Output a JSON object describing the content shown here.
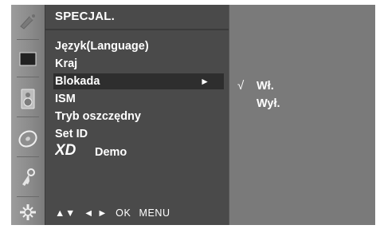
{
  "menu": {
    "title": "SPECJAL.",
    "items": [
      {
        "label": "Język(Language)"
      },
      {
        "label": "Kraj"
      },
      {
        "label": "Blokada",
        "arrow": "►"
      },
      {
        "label": "ISM"
      },
      {
        "label": "Tryb oszczędny"
      },
      {
        "label": "Set ID"
      },
      {
        "label": "XD Demo",
        "logo": "XD",
        "text": "Demo"
      }
    ],
    "selected_index": 2
  },
  "submenu": {
    "check_mark": "√",
    "items": [
      {
        "label": "Wł.",
        "checked": true
      },
      {
        "label": "Wył.",
        "checked": false
      }
    ]
  },
  "nav_hint": {
    "updown": "▲▼",
    "leftright": "◄ ►",
    "ok": "OK",
    "menu": "MENU"
  },
  "icons": [
    "satellite-icon",
    "picture-icon",
    "speaker-icon",
    "disc-icon",
    "key-icon",
    "settings-icon"
  ],
  "colors": {
    "menu_bg": "#4a4a4a",
    "selected_bg": "#2e2e2e",
    "sub_bg": "#7a7a7a",
    "text": "#ffffff"
  }
}
